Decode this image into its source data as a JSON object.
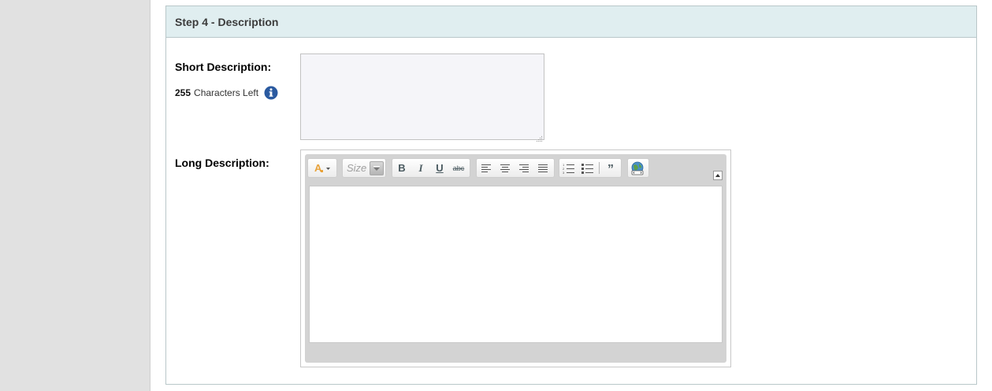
{
  "section": {
    "title": "Step 4 - Description"
  },
  "short_description": {
    "label": "Short Description:",
    "chars_left_count": "255",
    "chars_left_text": "Characters Left",
    "value": ""
  },
  "long_description": {
    "label": "Long Description:",
    "toolbar": {
      "size_placeholder": "Size",
      "buttons": [
        "font-color",
        "size",
        "bold",
        "italic",
        "underline",
        "strikethrough",
        "align-left",
        "align-center",
        "align-right",
        "justify",
        "numbered-list",
        "bulleted-list",
        "blockquote",
        "source"
      ],
      "bold_label": "B",
      "italic_label": "I",
      "underline_label": "U",
      "strike_label": "abc",
      "quote_label": "”"
    },
    "value": ""
  },
  "colors": {
    "header_bg": "#e0eef0",
    "panel_border": "#b9c7c9",
    "gutter_bg": "#e1e1e1",
    "textarea_bg": "#f5f5f9",
    "info_icon": "#2a5aa0",
    "editor_frame": "#d3d3d3"
  }
}
